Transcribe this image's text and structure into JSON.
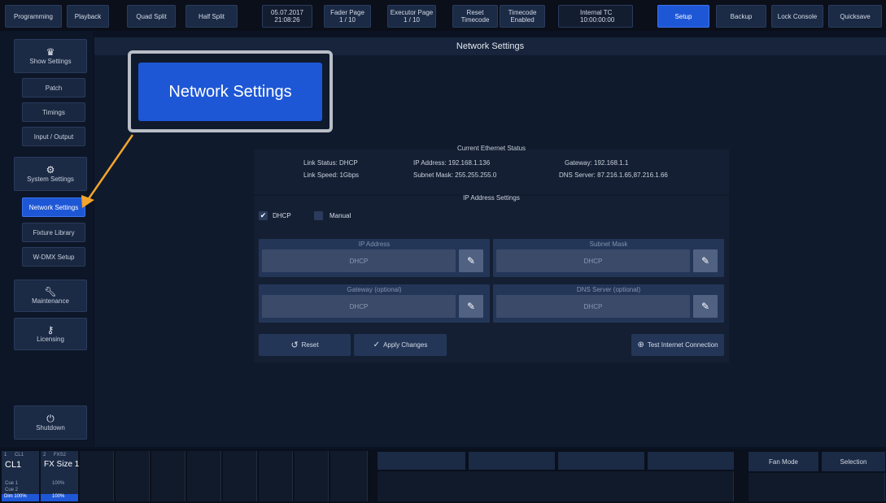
{
  "topbar": {
    "programming": "Programming",
    "playback": "Playback",
    "quad_split": "Quad Split",
    "half_split": "Half Split",
    "date": "05.07.2017",
    "time": "21:08:26",
    "fader_page_label": "Fader Page",
    "fader_page_value": "1 / 10",
    "executor_page_label": "Executor Page",
    "executor_page_value": "1 / 10",
    "reset_label": "Reset",
    "reset_sub": "Timecode",
    "timecode_label": "Timecode",
    "timecode_sub": "Enabled",
    "internal_tc_label": "Internal TC",
    "internal_tc_value": "10:00:00:00",
    "setup": "Setup",
    "backup": "Backup",
    "lock_console": "Lock Console",
    "quicksave": "Quicksave"
  },
  "sidebar": {
    "show_settings": "Show Settings",
    "patch": "Patch",
    "timings": "Timings",
    "input_output": "Input / Output",
    "system_settings": "System Settings",
    "network_settings": "Network Settings",
    "fixture_library": "Fixture Library",
    "wdmx_setup": "W-DMX Setup",
    "maintenance": "Maintenance",
    "licensing": "Licensing",
    "shutdown": "Shutdown"
  },
  "main": {
    "title": "Network Settings",
    "callout_label": "Network Settings",
    "status": {
      "title": "Current Ethernet Status",
      "link_status": "Link Status: DHCP",
      "link_speed": "Link Speed: 1Gbps",
      "ip_address": "IP Address: 192.168.1.136",
      "subnet_mask": "Subnet Mask: 255.255.255.0",
      "gateway": "Gateway: 192.168.1.1",
      "dns_server": "DNS Server: 87.216.1.65,87.216.1.66"
    },
    "ip_settings": {
      "title": "IP Address Settings",
      "dhcp": "DHCP",
      "dhcp_checked": true,
      "manual": "Manual",
      "fields": [
        {
          "label": "IP Address",
          "value": "DHCP"
        },
        {
          "label": "Subnet Mask",
          "value": "DHCP"
        },
        {
          "label": "Gateway (optional)",
          "value": "DHCP"
        },
        {
          "label": "DNS Server (optional)",
          "value": "DHCP"
        }
      ],
      "reset": "Reset",
      "apply_changes": "Apply Changes",
      "test_connection": "Test Internet Connection"
    }
  },
  "bottom": {
    "fader1_num": "1",
    "fader1_tag": "CL1",
    "fader1_name": "CL1",
    "fader1_cue1": "Cue 1",
    "fader1_cue2": "Cue 2",
    "fader1_dim": "Dim 100%",
    "fader2_num": "2",
    "fader2_tag": "FXS2",
    "fader2_name": "FX Size 1",
    "fader2_val": "100%",
    "fader2_pct": "100%",
    "fan_mode": "Fan Mode",
    "selection": "Selection"
  },
  "colors": {
    "accent": "#1e57d6",
    "button": "#1b2a45",
    "background": "#0b1322",
    "callout_arrow": "#f3a52b"
  }
}
